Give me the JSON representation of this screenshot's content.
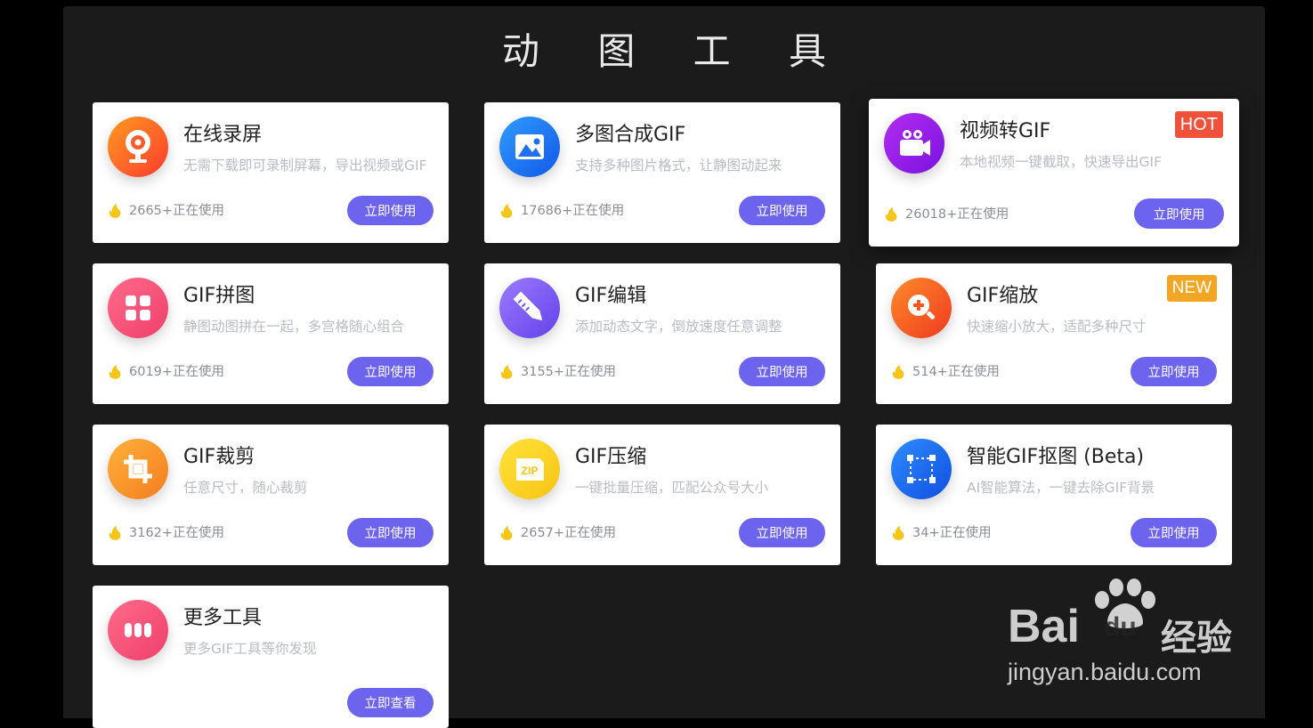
{
  "page": {
    "title": "动 图 工 具"
  },
  "colors": {
    "button": "#6c63ef",
    "hot_badge": "#f0513a",
    "new_badge": "#f3a623",
    "flame": "#f5c518"
  },
  "tools": [
    {
      "icon": "camera-icon",
      "title": "在线录屏",
      "desc": "无需下载即可录制屏幕，导出视频或GIF",
      "usage": "2665+正在使用",
      "button": "立即使用"
    },
    {
      "icon": "image-icon",
      "title": "多图合成GIF",
      "desc": "支持多种图片格式，让静图动起来",
      "usage": "17686+正在使用",
      "button": "立即使用"
    },
    {
      "icon": "video-camera-icon",
      "title": "视频转GIF",
      "desc": "本地视频一键截取，快速导出GIF",
      "usage": "26018+正在使用",
      "button": "立即使用",
      "badge": "HOT"
    },
    {
      "icon": "grid-icon",
      "title": "GIF拼图",
      "desc": "静图动图拼在一起，多宫格随心组合",
      "usage": "6019+正在使用",
      "button": "立即使用"
    },
    {
      "icon": "pencil-ruler-icon",
      "title": "GIF编辑",
      "desc": "添加动态文字，倒放速度任意调整",
      "usage": "3155+正在使用",
      "button": "立即使用"
    },
    {
      "icon": "zoom-in-icon",
      "title": "GIF缩放",
      "desc": "快速缩小放大，适配多种尺寸",
      "usage": "514+正在使用",
      "button": "立即使用",
      "badge": "NEW"
    },
    {
      "icon": "crop-icon",
      "title": "GIF裁剪",
      "desc": "任意尺寸，随心裁剪",
      "usage": "3162+正在使用",
      "button": "立即使用"
    },
    {
      "icon": "zip-icon",
      "title": "GIF压缩",
      "desc": "一键批量压缩，匹配公众号大小",
      "usage": "2657+正在使用",
      "button": "立即使用"
    },
    {
      "icon": "select-frame-icon",
      "title": "智能GIF抠图 (Beta)",
      "desc": "AI智能算法，一键去除GIF背景",
      "usage": "34+正在使用",
      "button": "立即使用"
    },
    {
      "icon": "more-dots-icon",
      "title": "更多工具",
      "desc": "更多GIF工具等你发现",
      "usage": "",
      "button": "立即查看"
    }
  ],
  "watermark": {
    "brand": "Bai",
    "brand_du": "du",
    "suffix": "经验",
    "url": "jingyan.baidu.com"
  }
}
